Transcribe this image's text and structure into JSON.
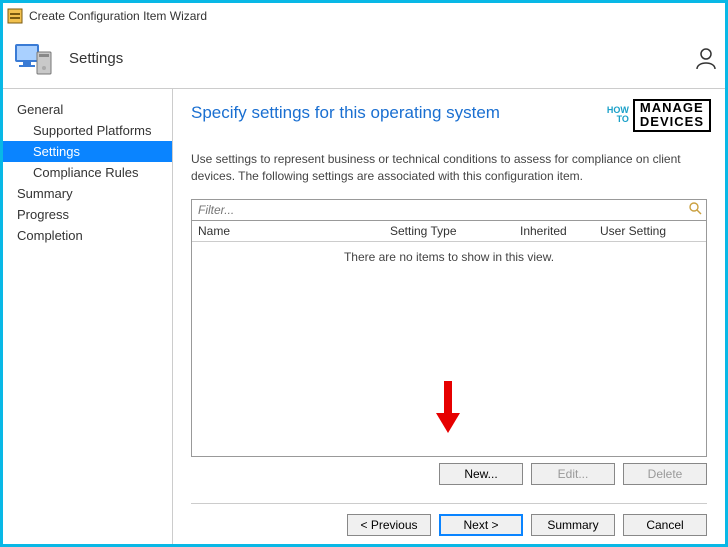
{
  "window": {
    "title": "Create Configuration Item Wizard"
  },
  "header": {
    "title": "Settings"
  },
  "sidebar": {
    "items": [
      {
        "label": "General",
        "sub": false,
        "selected": false
      },
      {
        "label": "Supported Platforms",
        "sub": true,
        "selected": false
      },
      {
        "label": "Settings",
        "sub": true,
        "selected": true
      },
      {
        "label": "Compliance Rules",
        "sub": true,
        "selected": false
      },
      {
        "label": "Summary",
        "sub": false,
        "selected": false
      },
      {
        "label": "Progress",
        "sub": false,
        "selected": false
      },
      {
        "label": "Completion",
        "sub": false,
        "selected": false
      }
    ]
  },
  "content": {
    "heading": "Specify settings for this operating system",
    "description": "Use settings to represent business or technical conditions to assess for compliance on client devices. The following settings are associated with this configuration item.",
    "filter_placeholder": "Filter...",
    "columns": {
      "name": "Name",
      "type": "Setting Type",
      "inherited": "Inherited",
      "user": "User Setting"
    },
    "empty_message": "There are no items to show in this view.",
    "item_buttons": {
      "new": "New...",
      "edit": "Edit...",
      "delete": "Delete"
    },
    "wizard_buttons": {
      "previous": "< Previous",
      "next": "Next >",
      "summary": "Summary",
      "cancel": "Cancel"
    }
  },
  "watermark": {
    "how": "HOW",
    "to": "TO",
    "manage": "MANAGE",
    "devices": "DEVICES"
  }
}
